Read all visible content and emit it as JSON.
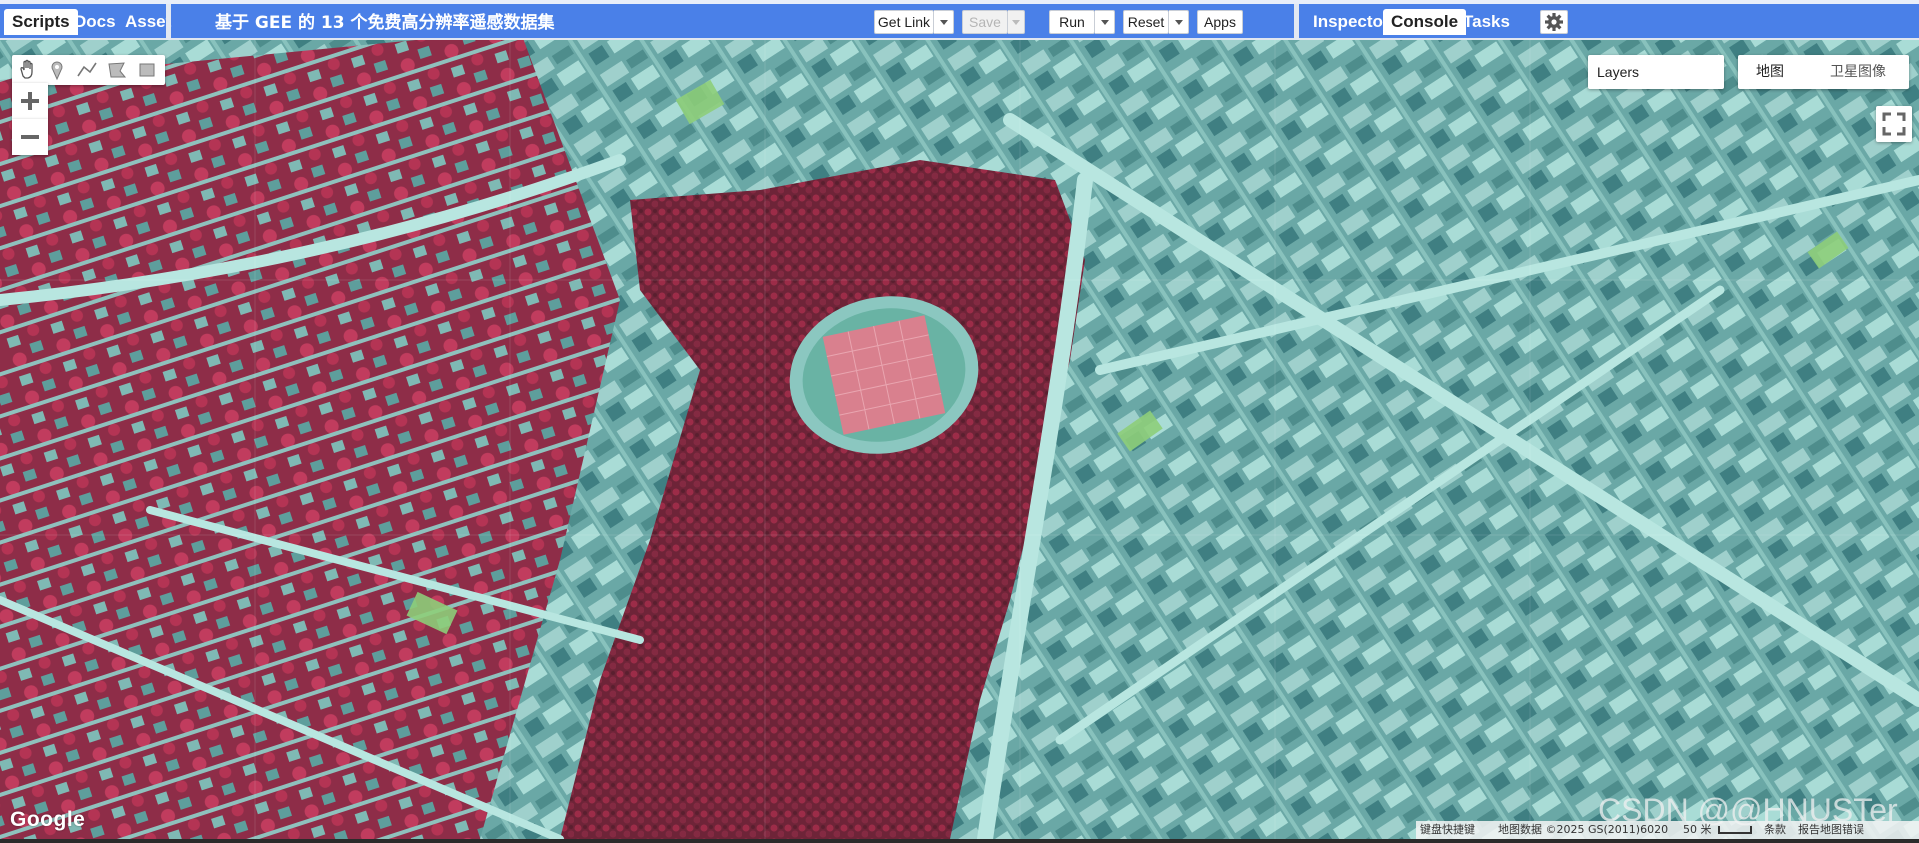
{
  "header": {
    "left_tabs": [
      {
        "label": "Scripts",
        "active": true
      },
      {
        "label": "Docs",
        "active": false
      },
      {
        "label": "Asset",
        "active": false
      }
    ],
    "script_title": "基于 GEE 的 13 个免费高分辨率遥感数据集",
    "buttons": {
      "get_link": "Get Link",
      "save": "Save",
      "run": "Run",
      "reset": "Reset",
      "apps": "Apps"
    },
    "right_tabs": [
      {
        "label": "Inspector",
        "active": false
      },
      {
        "label": "Console",
        "active": true
      },
      {
        "label": "Tasks",
        "active": false
      }
    ]
  },
  "map": {
    "drawing_tools": [
      "hand-icon",
      "marker-icon",
      "line-icon",
      "polygon-icon",
      "rectangle-icon"
    ],
    "zoom_in": "+",
    "zoom_out": "−",
    "layers_label": "Layers",
    "map_type_options": [
      "地图",
      "卫星图像"
    ],
    "google_logo": "Google",
    "watermark": "CSDN @@HNUSTer",
    "attribution": {
      "shortcuts": "键盘快捷键",
      "map_data": "地图数据 ©2025 GS(2011)6020",
      "scale": "50 米",
      "terms": "条款",
      "report": "报告地图错误"
    }
  },
  "colors": {
    "topbar": "#4a80e8",
    "vegetation": "#b02a48",
    "urban": "#6aa8a6",
    "field": "#d9808e"
  }
}
